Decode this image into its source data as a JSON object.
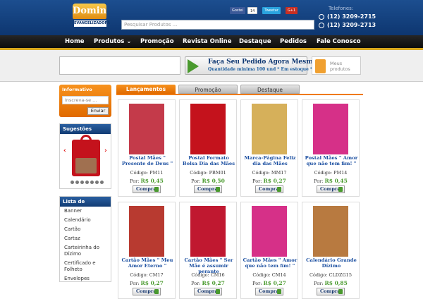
{
  "header": {
    "logo_text": "Domin",
    "logo_sub": "EVANGELIZADORA",
    "search_placeholder": "Pesquisar Produtos ...",
    "social": {
      "gostei": "Gostei",
      "count": "14",
      "tweet": "Tweetar",
      "gplus": "G+1"
    },
    "telefones_label": "Telefones:",
    "phones": [
      "(12) 3209-2715",
      "(12) 3209-2713"
    ]
  },
  "nav": [
    "Home",
    "Produtos",
    "Promoção",
    "Revista Online",
    "Destaque",
    "Pedidos",
    "Fale Conosco"
  ],
  "banner": {
    "title": "Faça Seu Pedido Agora Mesmo!!!",
    "subtitle": "Quantidade minima 100 und * Em estoque *"
  },
  "cart": {
    "label": "Meus produtos"
  },
  "informativo": {
    "title": "Informativo",
    "placeholder": "Inscreva-se ...",
    "button": "Enviar"
  },
  "sugestoes": {
    "title": "Sugestões"
  },
  "lista": {
    "title": "Lista de Produtos",
    "items": [
      "Banner",
      "Calendário",
      "Cartão",
      "Cartaz",
      "Carteirinha do Dízimo",
      "Certificado e Folheto",
      "Envelopes"
    ]
  },
  "tabs": [
    "Lançamentos",
    "Promoção",
    "Destaque"
  ],
  "products": [
    {
      "name": "Postal Mães \" Presente de Deus \"",
      "code": "Código: PM11",
      "price": "R$ 0,45",
      "button": "Comprar",
      "color": "#c43a4a"
    },
    {
      "name": "Postal Formato Bolsa Dia das Mães",
      "code": "Código: PBM01",
      "price": "R$ 0,50",
      "button": "Comprar",
      "color": "#c4121c"
    },
    {
      "name": "Marca-Página Feliz dia das Mães",
      "code": "Código: MM17",
      "price": "R$ 0,27",
      "button": "Comprar",
      "color": "#d6b05a"
    },
    {
      "name": "Postal Mães \" Amor que não tem fim! \"",
      "code": "Código: PM14",
      "price": "R$ 0,45",
      "button": "Comprar",
      "color": "#d63088"
    },
    {
      "name": "Cartão Mães \" Meu Amor Eterno \"",
      "code": "Código: CM17",
      "price": "R$ 0,27",
      "button": "Comprar",
      "color": "#b83a30"
    },
    {
      "name": "Cartão Mães \" Ser Mãe é assumir perante",
      "code": "Código: CM16",
      "price": "R$ 0,27",
      "button": "Comprar",
      "color": "#c01830"
    },
    {
      "name": "Cartão Mães \" Amor que não tem fim! \"",
      "code": "Código: CM14",
      "price": "R$ 0,27",
      "button": "Comprar",
      "color": "#d63088"
    },
    {
      "name": "Calendário Grande Dízimo",
      "code": "Código: CLDZG15",
      "price": "R$ 0,85",
      "button": "Comprar",
      "color": "#b87a40"
    }
  ],
  "por": "Por:"
}
